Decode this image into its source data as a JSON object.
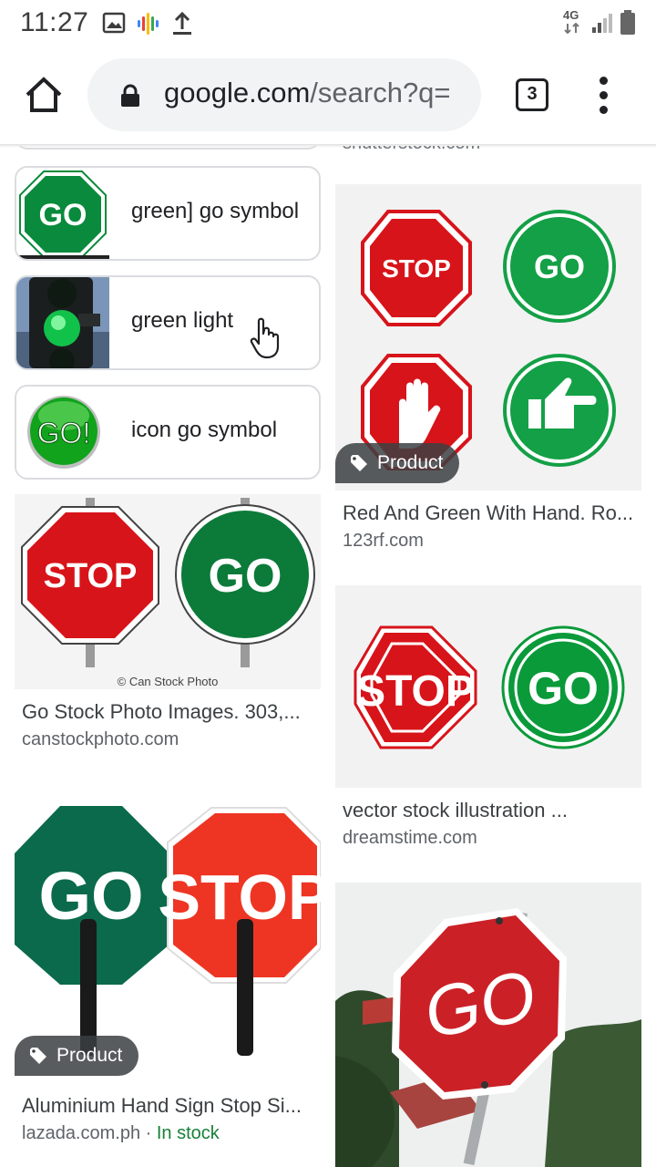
{
  "status_bar": {
    "time": "11:27",
    "network": "4G",
    "icons": [
      "image-icon",
      "google-assistant-icon",
      "upload-icon",
      "signal-icon",
      "battery-icon"
    ]
  },
  "browser": {
    "url_host": "google.com",
    "url_path": "/search?q=",
    "tab_count": "3",
    "icons": [
      "home-icon",
      "lock-icon",
      "menu-icon"
    ]
  },
  "chips": [
    {
      "label": "green] go symbol"
    },
    {
      "label": "green light"
    },
    {
      "label": "icon go symbol"
    }
  ],
  "results": [
    {
      "title": "Go Stock Photo Images. 303,...",
      "source": "canstockphoto.com",
      "watermark": "© Can Stock Photo",
      "sign_left": "STOP",
      "sign_right": "GO"
    },
    {
      "title": "Aluminium Hand Sign Stop Si...",
      "source": "lazada.com.ph",
      "stock_sep": " · ",
      "stock": "In stock",
      "badge": "Product",
      "sign_left": "GO",
      "sign_right": "STOP"
    },
    {
      "title": "Red And Green With Hand. Ro...",
      "source": "123rf.com",
      "badge": "Product",
      "sign_top_left": "STOP",
      "sign_top_right": "GO"
    },
    {
      "title": "vector stock illustration ...",
      "source": "dreamstime.com",
      "sign_left": "STOP",
      "sign_right": "GO"
    },
    {
      "sign": "GO"
    }
  ],
  "colors": {
    "accent_green": "#0a9a3a",
    "stop_red": "#d7141a",
    "in_stock": "#188038"
  }
}
